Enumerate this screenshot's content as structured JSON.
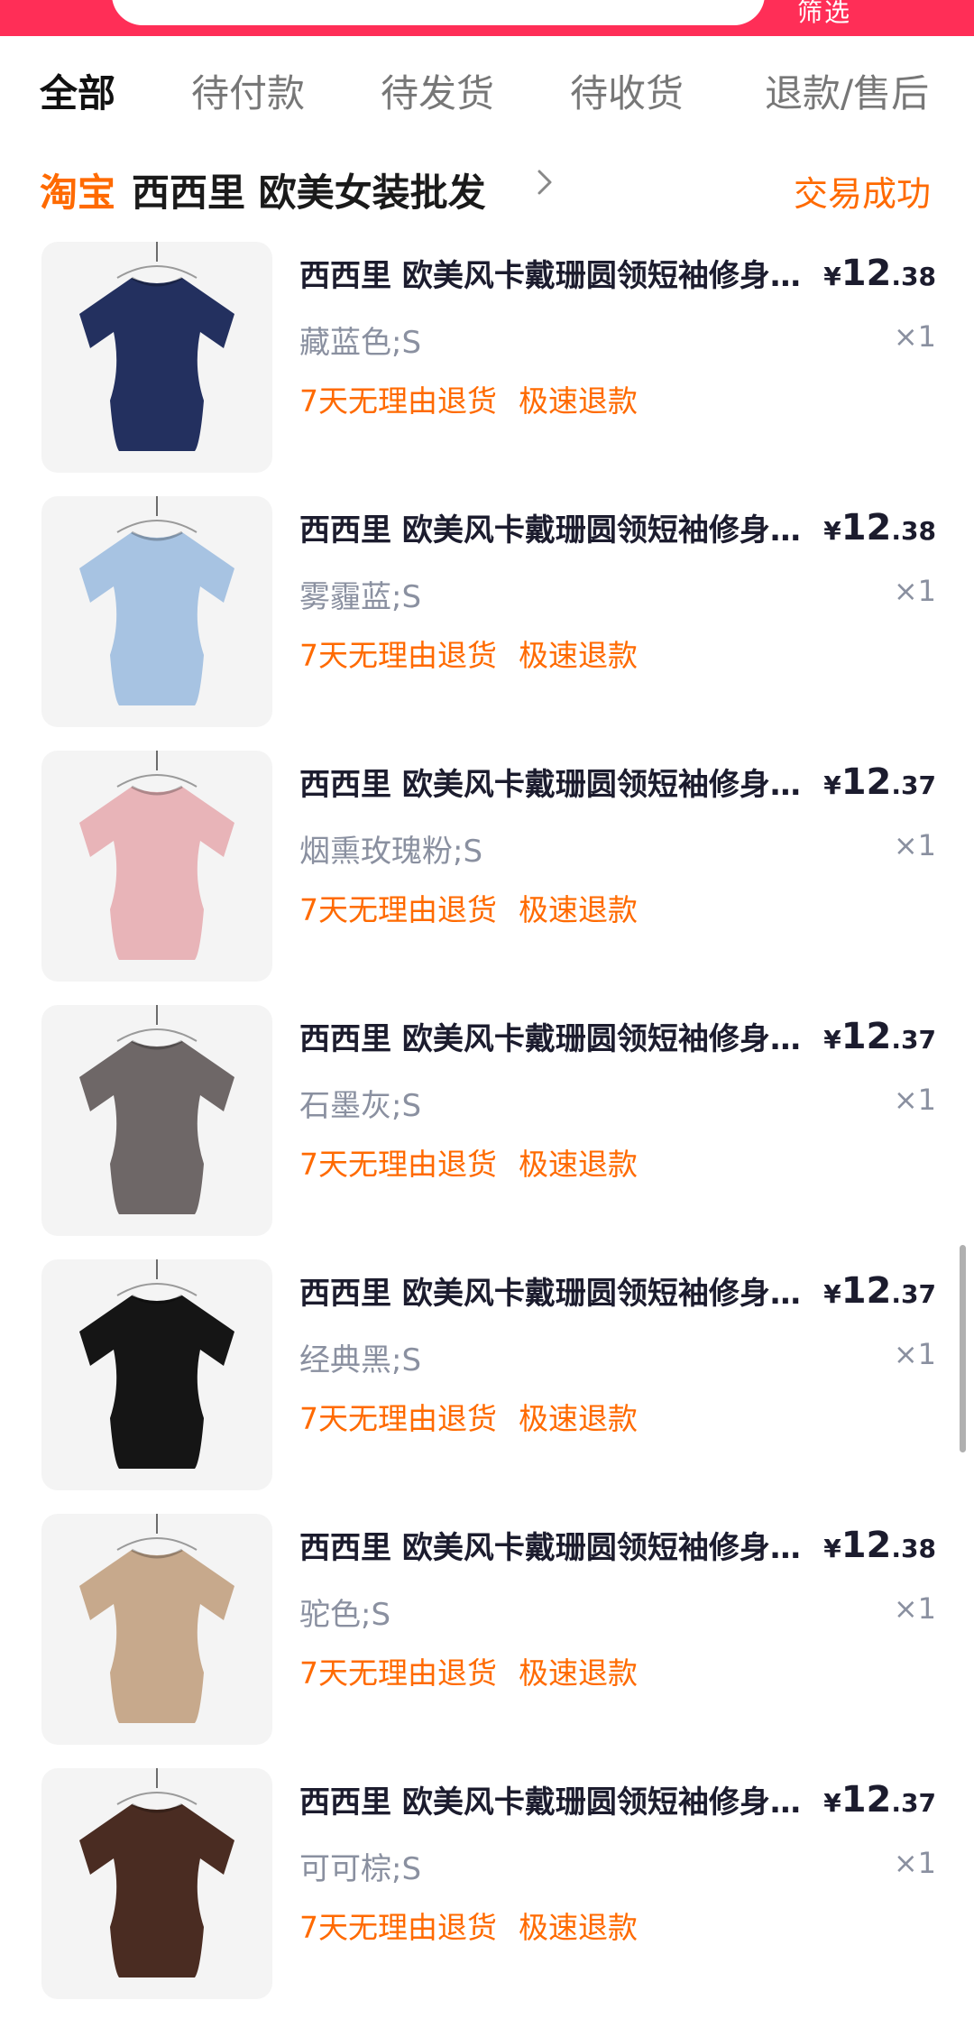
{
  "header": {
    "filter_label": "筛选",
    "colors": {
      "brand_red": "#ff2e57",
      "accent_orange": "#ff6a00"
    }
  },
  "tabs": [
    {
      "label": "全部",
      "active": true
    },
    {
      "label": "待付款",
      "active": false
    },
    {
      "label": "待发货",
      "active": false
    },
    {
      "label": "待收货",
      "active": false
    },
    {
      "label": "退款/售后",
      "active": false
    }
  ],
  "shop": {
    "platform_logo_text": "淘宝",
    "name": "西西里 欧美女装批发",
    "status": "交易成功"
  },
  "items": [
    {
      "title": "西西里 欧美风卡戴珊圆领短袖修身T恤",
      "yen": "¥",
      "price_int": "12",
      "price_dec": ".38",
      "variant": "藏蓝色;S",
      "qty": "×1",
      "tag1": "7天无理由退货",
      "tag2": "极速退款",
      "shirt_color": "#23305f"
    },
    {
      "title": "西西里 欧美风卡戴珊圆领短袖修身T恤",
      "yen": "¥",
      "price_int": "12",
      "price_dec": ".38",
      "variant": "雾霾蓝;S",
      "qty": "×1",
      "tag1": "7天无理由退货",
      "tag2": "极速退款",
      "shirt_color": "#a7c3e2"
    },
    {
      "title": "西西里 欧美风卡戴珊圆领短袖修身T恤",
      "yen": "¥",
      "price_int": "12",
      "price_dec": ".37",
      "variant": "烟熏玫瑰粉;S",
      "qty": "×1",
      "tag1": "7天无理由退货",
      "tag2": "极速退款",
      "shirt_color": "#e8b4b8"
    },
    {
      "title": "西西里 欧美风卡戴珊圆领短袖修身T恤",
      "yen": "¥",
      "price_int": "12",
      "price_dec": ".37",
      "variant": "石墨灰;S",
      "qty": "×1",
      "tag1": "7天无理由退货",
      "tag2": "极速退款",
      "shirt_color": "#6e6767"
    },
    {
      "title": "西西里 欧美风卡戴珊圆领短袖修身T恤",
      "yen": "¥",
      "price_int": "12",
      "price_dec": ".37",
      "variant": "经典黑;S",
      "qty": "×1",
      "tag1": "7天无理由退货",
      "tag2": "极速退款",
      "shirt_color": "#151515"
    },
    {
      "title": "西西里 欧美风卡戴珊圆领短袖修身T恤",
      "yen": "¥",
      "price_int": "12",
      "price_dec": ".38",
      "variant": "驼色;S",
      "qty": "×1",
      "tag1": "7天无理由退货",
      "tag2": "极速退款",
      "shirt_color": "#c7a98c"
    },
    {
      "title": "西西里 欧美风卡戴珊圆领短袖修身T恤",
      "yen": "¥",
      "price_int": "12",
      "price_dec": ".37",
      "variant": "可可棕;S",
      "qty": "×1",
      "tag1": "7天无理由退货",
      "tag2": "极速退款",
      "shirt_color": "#4a2c22"
    }
  ]
}
